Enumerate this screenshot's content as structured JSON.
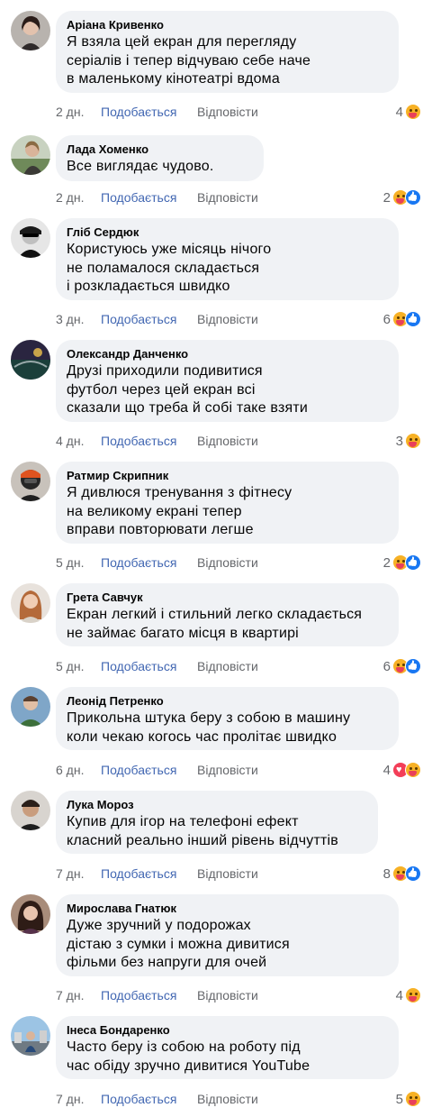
{
  "labels": {
    "like": "Подобається",
    "reply": "Відповісти"
  },
  "colors": {
    "link": "#4267b2",
    "bubble": "#f0f2f5",
    "meta": "#65676b"
  },
  "comments": [
    {
      "author": "Аріана Кривенко",
      "text": "Я взяла цей екран для перегляду\nсеріалів і тепер відчуваю себе наче\nв маленькому кінотеатрі вдома",
      "time": "2 дн.",
      "reactions": "4",
      "icons": [
        "care-icon"
      ]
    },
    {
      "author": "Лада Хоменко",
      "text": "Все виглядає чудово.",
      "time": "2 дн.",
      "reactions": "2",
      "icons": [
        "care-icon",
        "like-icon"
      ]
    },
    {
      "author": "Гліб Сердюк",
      "text": "Користуюсь уже місяць нічого\nне поламалося складається\nі розкладається швидко",
      "time": "3 дн.",
      "reactions": "6",
      "icons": [
        "care-icon",
        "like-icon"
      ]
    },
    {
      "author": "Олександр Данченко",
      "text": "Друзі приходили подивитися\nфутбол через цей екран всі\nсказали що треба й собі таке взяти",
      "time": "4 дн.",
      "reactions": "3",
      "icons": [
        "care-icon"
      ]
    },
    {
      "author": "Ратмир Скрипник",
      "text": "Я дивлюся тренування з фітнесу\nна великому екрані тепер\nвправи повторювати легше",
      "time": "5 дн.",
      "reactions": "2",
      "icons": [
        "care-icon",
        "like-icon"
      ]
    },
    {
      "author": "Грета Савчук",
      "text": "Екран легкий і стильний легко складається\nне займає багато місця в квартирі",
      "time": "5 дн.",
      "reactions": "6",
      "icons": [
        "care-icon",
        "like-icon"
      ]
    },
    {
      "author": "Леонід Петренко",
      "text": "Прикольна штука беру з собою в машину\nколи чекаю когось час пролітає швидко",
      "time": "6 дн.",
      "reactions": "4",
      "icons": [
        "love-icon",
        "care-icon"
      ]
    },
    {
      "author": "Лука Мороз",
      "text": "Купив для ігор на телефоні ефект\nкласний реально інший рівень відчуттів",
      "time": "7 дн.",
      "reactions": "8",
      "icons": [
        "care-icon",
        "like-icon"
      ]
    },
    {
      "author": "Мирослава Гнатюк",
      "text": "Дуже зручний у подорожах\nдістаю з сумки і можна дивитися\nфільми без напруги для очей",
      "time": "7 дн.",
      "reactions": "4",
      "icons": [
        "care-icon"
      ]
    },
    {
      "author": "Інеса Бондаренко",
      "text": "Часто беру із собою на роботу під\nчас обіду зручно дивитися YouTube",
      "time": "7 дн.",
      "reactions": "5",
      "icons": [
        "care-icon"
      ]
    }
  ]
}
